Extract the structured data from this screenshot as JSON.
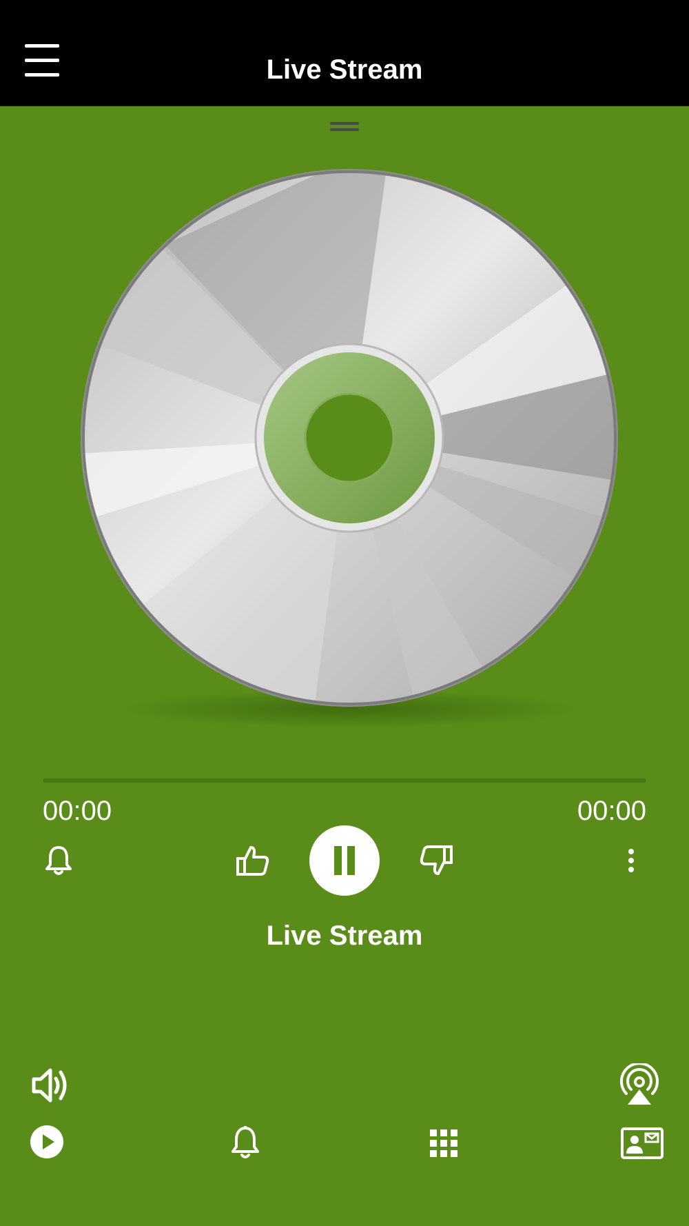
{
  "header": {
    "title": "Live Stream",
    "menu_icon": "hamburger-menu-icon"
  },
  "player": {
    "artwork_icon": "compact-disc",
    "progress": 0,
    "elapsed": "00:00",
    "duration": "00:00",
    "track_title": "Live Stream",
    "state": "playing"
  },
  "controls": {
    "alarm_icon": "bell-icon",
    "like_icon": "thumbs-up-icon",
    "pause_icon": "pause-icon",
    "dislike_icon": "thumbs-down-icon",
    "more_icon": "vertical-dots-icon",
    "volume_icon": "speaker-icon",
    "cast_icon": "airplay-icon"
  },
  "bottom_nav": [
    {
      "icon": "play-circle-icon"
    },
    {
      "icon": "bell-icon"
    },
    {
      "icon": "grid-icon"
    },
    {
      "icon": "contact-card-icon"
    }
  ],
  "colors": {
    "background": "#5a8c1a",
    "header": "#000000",
    "accent": "#ffffff"
  }
}
